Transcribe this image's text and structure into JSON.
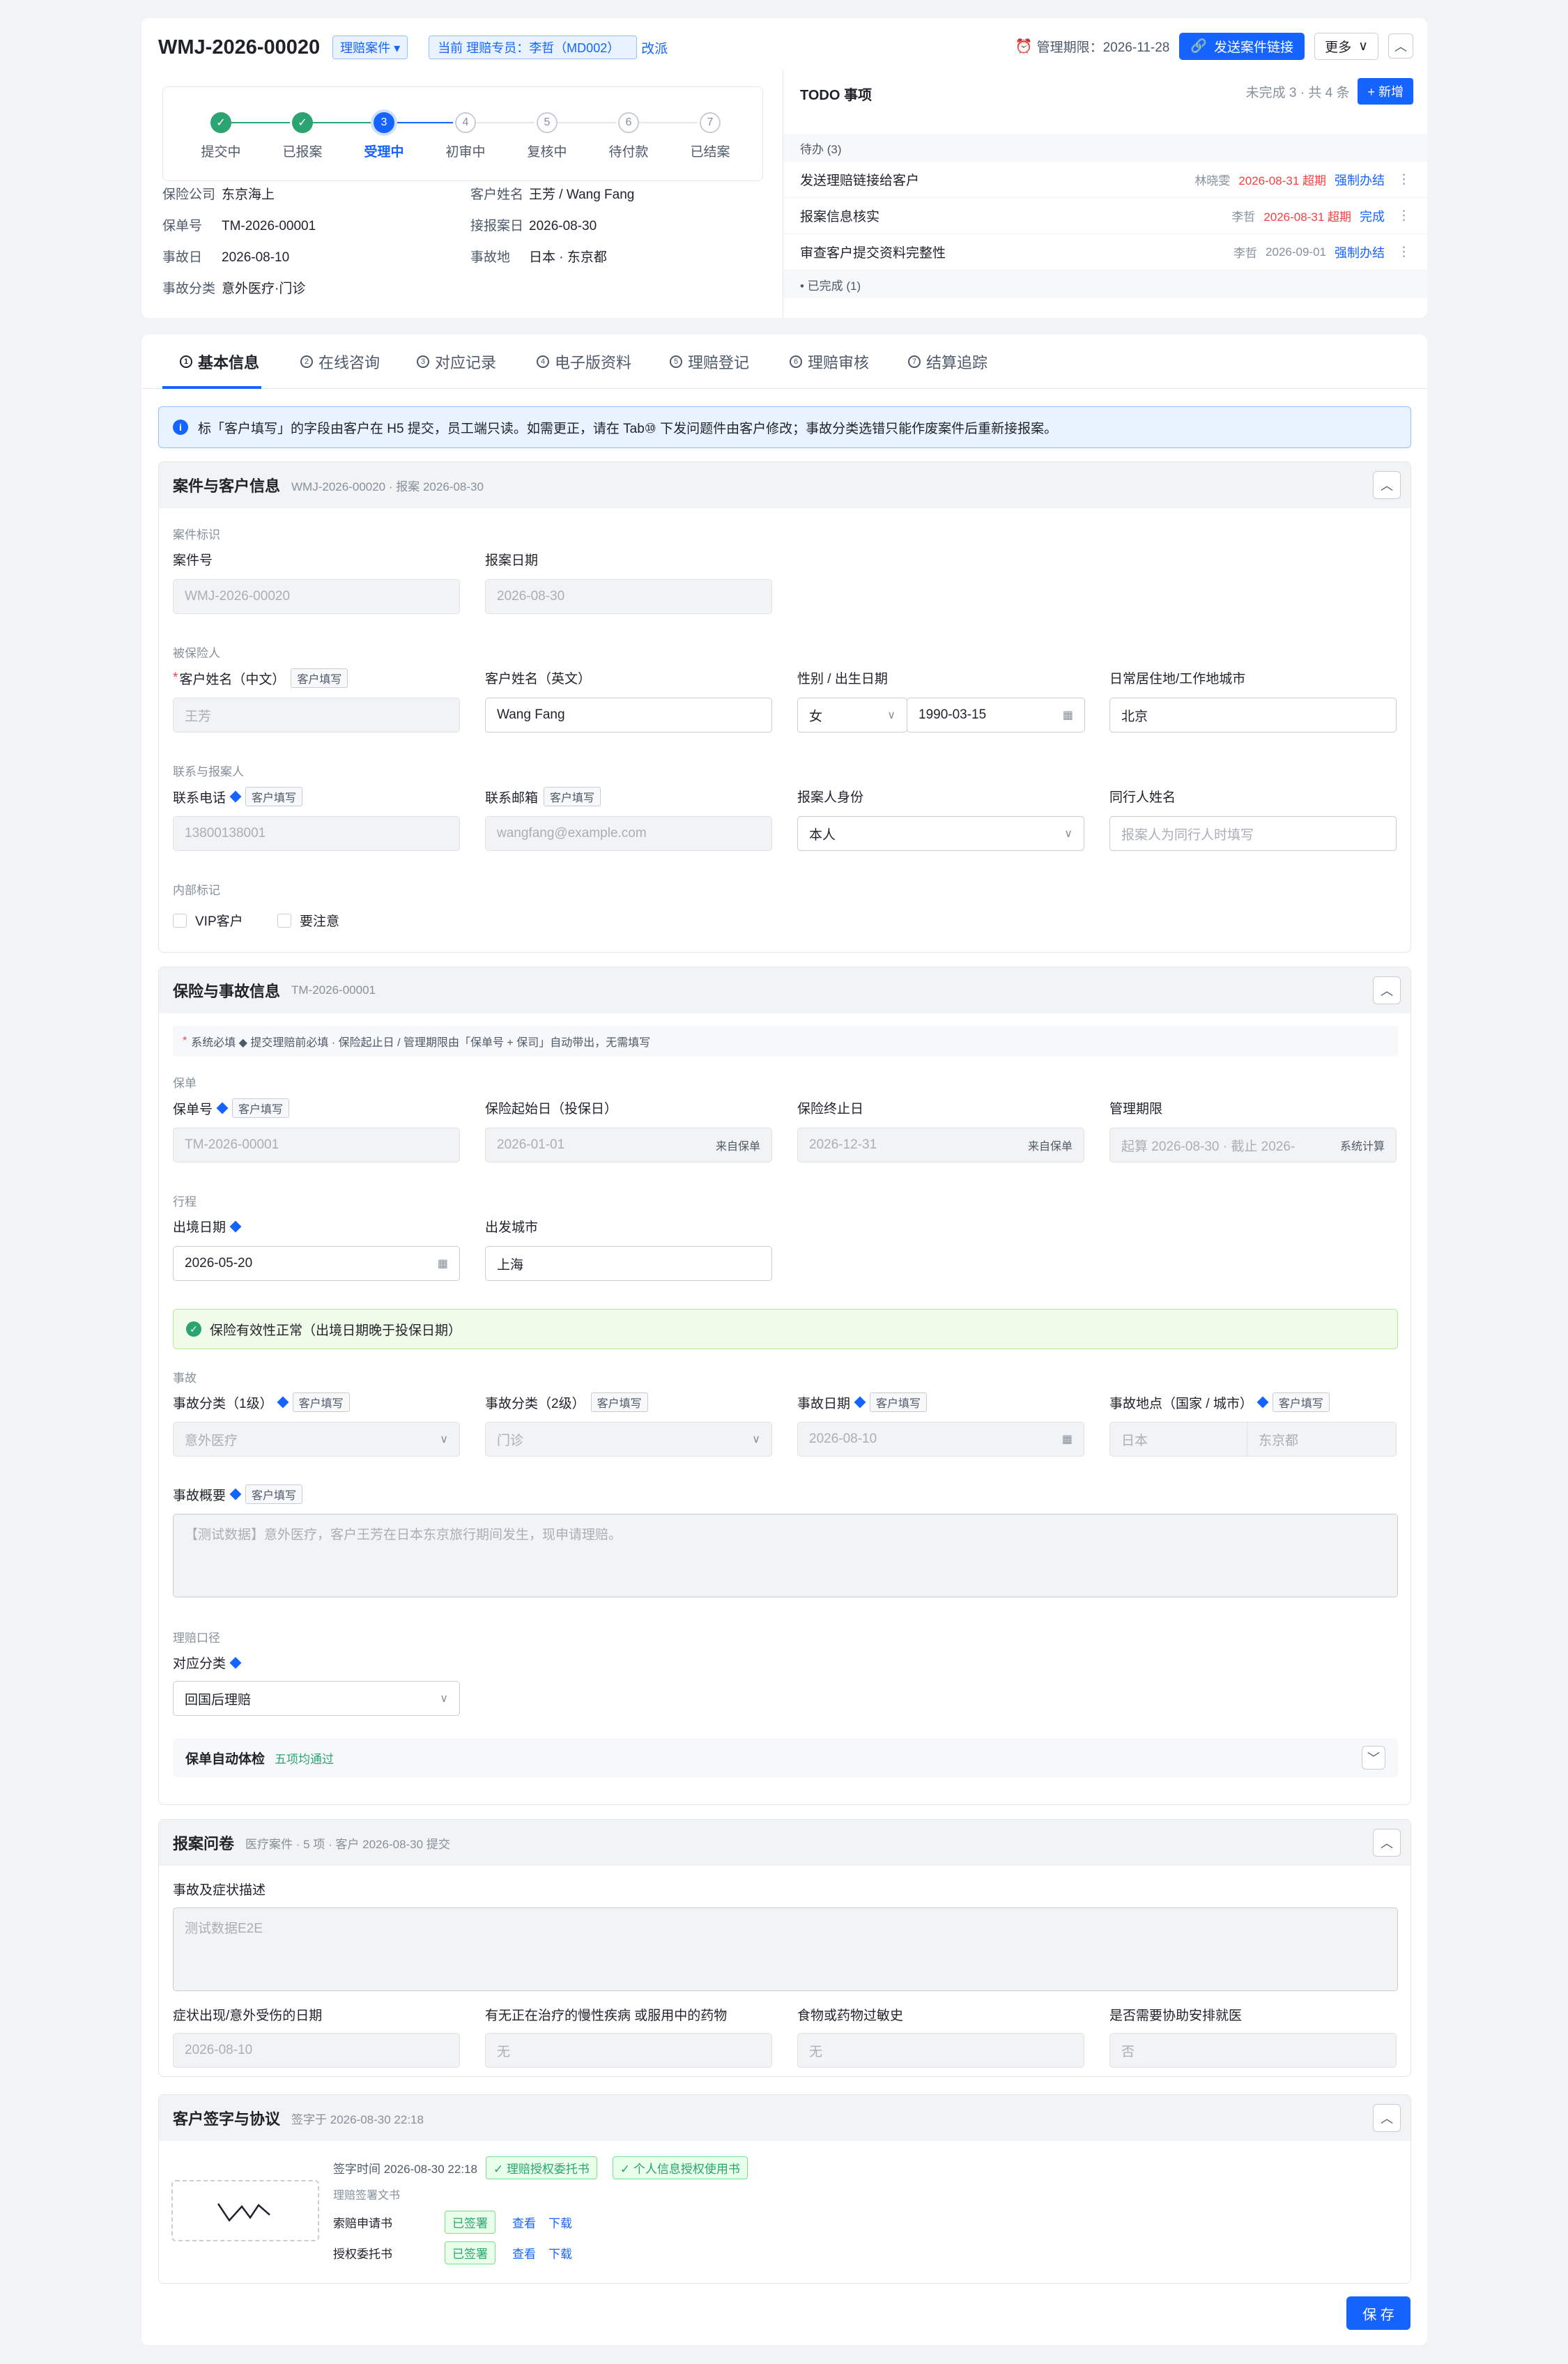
{
  "header": {
    "case_id": "WMJ-2026-00020",
    "case_type": "理赔案件 ▾",
    "owner_tag": "当前 理赔专员：李哲（MD002）",
    "reassign": "改派",
    "deadline_label": "管理期限：2026-11-28",
    "send_link": "发送案件链接",
    "more": "更多",
    "collapse": "^"
  },
  "steps": [
    {
      "n": "✓",
      "label": "提交中",
      "state": "done"
    },
    {
      "n": "✓",
      "label": "已报案",
      "state": "done"
    },
    {
      "n": "3",
      "label": "受理中",
      "state": "cur"
    },
    {
      "n": "4",
      "label": "初审中",
      "state": "todo"
    },
    {
      "n": "5",
      "label": "复核中",
      "state": "todo"
    },
    {
      "n": "6",
      "label": "待付款",
      "state": "todo"
    },
    {
      "n": "7",
      "label": "已结案",
      "state": "todo"
    }
  ],
  "case_info": [
    {
      "k": "保险公司",
      "v": "东京海上"
    },
    {
      "k": "客户姓名",
      "v": "王芳 / Wang Fang"
    },
    {
      "k": "保单号",
      "v": "TM-2026-00001"
    },
    {
      "k": "接报案日",
      "v": "2026-08-30"
    },
    {
      "k": "事故日",
      "v": "2026-08-10"
    },
    {
      "k": "事故地",
      "v": "日本 · 东京都"
    },
    {
      "k": "事故分类",
      "v": "意外医疗·门诊"
    }
  ],
  "todo": {
    "title": "TODO 事项",
    "summary": "未完成 3 · 共 4 条",
    "add": "+ 新增",
    "pending": "待办 (3)",
    "done": "• 已完成 (1)",
    "items": [
      {
        "title": "发送理赔链接给客户",
        "person": "林晓雯",
        "date": "2026-08-31 超期",
        "action": "强制办结",
        "more": "⋮"
      },
      {
        "title": "报案信息核实",
        "person": "李哲",
        "date": "2026-08-31 超期",
        "action": "完成",
        "more": "⋮"
      },
      {
        "title": "审查客户提交资料完整性",
        "person": "李哲",
        "date": "2026-09-01",
        "action": "强制办结",
        "more": "⋮"
      }
    ]
  },
  "tabs": [
    {
      "n": "1",
      "label": "基本信息"
    },
    {
      "n": "2",
      "label": "在线咨询"
    },
    {
      "n": "3",
      "label": "对应记录"
    },
    {
      "n": "4",
      "label": "电子版资料"
    },
    {
      "n": "5",
      "label": "理赔登记"
    },
    {
      "n": "6",
      "label": "理赔审核"
    },
    {
      "n": "7",
      "label": "结算追踪"
    }
  ],
  "notice": "标「客户填写」的字段由客户在 H5 提交，员工端只读。如需更正，请在 Tab⑩ 下发问题件由客户修改；事故分类选错只能作废案件后重新接报案。",
  "sec1": {
    "title": "案件与客户信息",
    "sub": "WMJ-2026-00020 · 报案 2026-08-30",
    "g1": "案件标识",
    "case_no_l": "案件号",
    "case_no_v": "WMJ-2026-00020",
    "report_date_l": "报案日期",
    "report_date_v": "2026-08-30",
    "g2": "被保险人",
    "name_cn_l": "客户姓名（中文）",
    "name_cn_v": "王芳",
    "name_en_l": "客户姓名（英文）",
    "name_en_v": "Wang Fang",
    "gender_l": "性别 / 出生日期",
    "gender_v": "女",
    "birth_v": "1990-03-15",
    "city_l": "日常居住地/工作地城市",
    "city_v": "北京",
    "g3": "联系与报案人",
    "phone_l": "联系电话",
    "phone_v": "13800138001",
    "email_l": "联系邮箱",
    "email_v": "wangfang@example.com",
    "reporter_l": "报案人身份",
    "reporter_v": "本人",
    "companion_l": "同行人姓名",
    "companion_ph": "报案人为同行人时填写",
    "g4": "内部标记",
    "vip": "VIP客户",
    "attention": "要注意",
    "star": "*",
    "ctag": "客户填写"
  },
  "sec2": {
    "title": "保险与事故信息",
    "sub": "TM-2026-00001",
    "legend": "系统必填 ◆ 提交理赔前必填 · 保险起止日 / 管理期限由「保单号 + 保司」自动带出，无需填写",
    "g1": "保单",
    "policy_l": "保单号",
    "policy_v": "TM-2026-00001",
    "start_l": "保险起始日（投保日）",
    "start_v": "2026-01-01",
    "from_policy": "来自保单",
    "end_l": "保险终止日",
    "end_v": "2026-12-31",
    "mgmt_l": "管理期限",
    "mgmt_v": "起算 2026-08-30 · 截止 2026-",
    "sys_calc": "系统计算",
    "g2": "行程",
    "depart_l": "出境日期",
    "depart_v": "2026-05-20",
    "city_l": "出发城市",
    "city_v": "上海",
    "valid": "保险有效性正常（出境日期晚于投保日期）",
    "g3": "事故",
    "cat1_l": "事故分类（1级）",
    "cat1_v": "意外医疗",
    "cat2_l": "事故分类（2级）",
    "cat2_v": "门诊",
    "acc_date_l": "事故日期",
    "acc_date_v": "2026-08-10",
    "place_l": "事故地点（国家 / 城市）",
    "country_v": "日本",
    "pcity_v": "东京都",
    "summary_l": "事故概要",
    "summary_v": "【测试数据】意外医疗，客户王芳在日本东京旅行期间发生，现申请理赔。",
    "g4": "理赔口径",
    "mapcat_l": "对应分类",
    "mapcat_v": "回国后理赔",
    "check_l": "保单自动体检",
    "check_v": "五项均通过"
  },
  "sec3": {
    "title": "报案问卷",
    "sub": "医疗案件 · 5 项 · 客户 2026-08-30 提交",
    "desc_l": "事故及症状描述",
    "desc_v": "测试数据E2E",
    "q1_l": "症状出现/意外受伤的日期",
    "q1_v": "2026-08-10",
    "q2_l": "有无正在治疗的慢性疾病 或服用中的药物",
    "q2_v": "无",
    "q3_l": "食物或药物过敏史",
    "q3_v": "无",
    "q4_l": "是否需要协助安排就医",
    "q4_v": "否"
  },
  "sec4": {
    "title": "客户签字与协议",
    "sub": "签字于 2026-08-30 22:18",
    "sign_time": "签字时间 2026-08-30 22:18",
    "auth1": "✓ 理赔授权委托书",
    "auth2": "✓ 个人信息授权使用书",
    "docs_l": "理赔签署文书",
    "doc1": "索赔申请书",
    "doc2": "授权委托书",
    "signed": "已签署",
    "view": "查看",
    "download": "下载"
  },
  "save": "保 存"
}
